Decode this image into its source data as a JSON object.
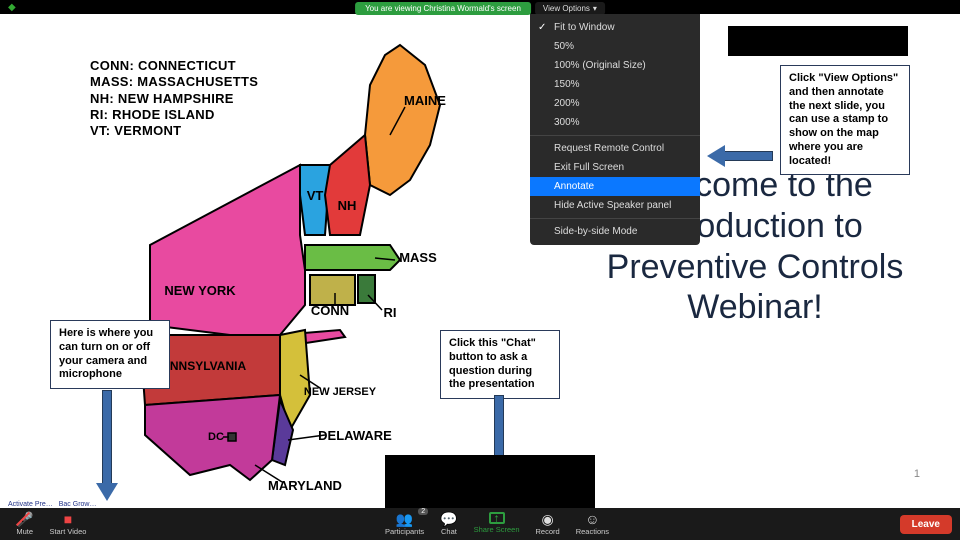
{
  "top": {
    "viewing_text": "You are viewing Christina Wormald's screen",
    "view_options_label": "View Options"
  },
  "view_menu": {
    "items": [
      {
        "label": "Fit to Window",
        "checked": true
      },
      {
        "label": "50%"
      },
      {
        "label": "100% (Original Size)"
      },
      {
        "label": "150%"
      },
      {
        "label": "200%"
      },
      {
        "label": "300%"
      },
      {
        "sep": true
      },
      {
        "label": "Request Remote Control"
      },
      {
        "label": "Exit Full Screen"
      },
      {
        "label": "Annotate",
        "selected": true
      },
      {
        "label": "Hide Active Speaker panel"
      },
      {
        "sep": true
      },
      {
        "label": "Side-by-side Mode"
      }
    ]
  },
  "legend": {
    "l1": "CONN: CONNECTICUT",
    "l2": "MASS: MASSACHUSETTS",
    "l3": "NH: NEW HAMPSHIRE",
    "l4": "RI: RHODE ISLAND",
    "l5": "VT: VERMONT"
  },
  "map_labels": {
    "maine": "MAINE",
    "vt": "VT",
    "nh": "NH",
    "mass": "MASS",
    "conn": "CONN",
    "ri": "RI",
    "newyork": "NEW YORK",
    "pennsylvania": "PENNSYLVANIA",
    "newjersey": "NEW JERSEY",
    "delaware": "DELAWARE",
    "maryland": "MARYLAND",
    "dc": "DC"
  },
  "welcome_text": "Welcome to the Introduction to Preventive Controls Webinar!",
  "callouts": {
    "right": "Click \"View Options\" and then annotate the next slide, you can use a stamp to show on the map where you are located!",
    "left": "Here is where you can turn on or off your camera and microphone",
    "mid": "Click this \"Chat\" button to ask a question during the presentation"
  },
  "slide_number": "1",
  "toolbar": {
    "mute": "Mute",
    "start_video": "Start Video",
    "participants": "Participants",
    "participants_count": "2",
    "chat": "Chat",
    "share_screen": "Share Screen",
    "record": "Record",
    "reactions": "Reactions",
    "leave": "Leave"
  },
  "status": {
    "a": "Activate Pre…",
    "b": "Bac Grow…"
  },
  "colors": {
    "maine": "#f59a3b",
    "vt": "#2aa3e0",
    "nh": "#e23a3a",
    "mass": "#6abd45",
    "conn": "#bfb14a",
    "ri": "#3a7a3a",
    "ny": "#e84aa0",
    "pa": "#c23a3a",
    "nj": "#d4c03a",
    "de": "#5a3a9a",
    "md": "#c23a9a",
    "dc": "#333"
  }
}
